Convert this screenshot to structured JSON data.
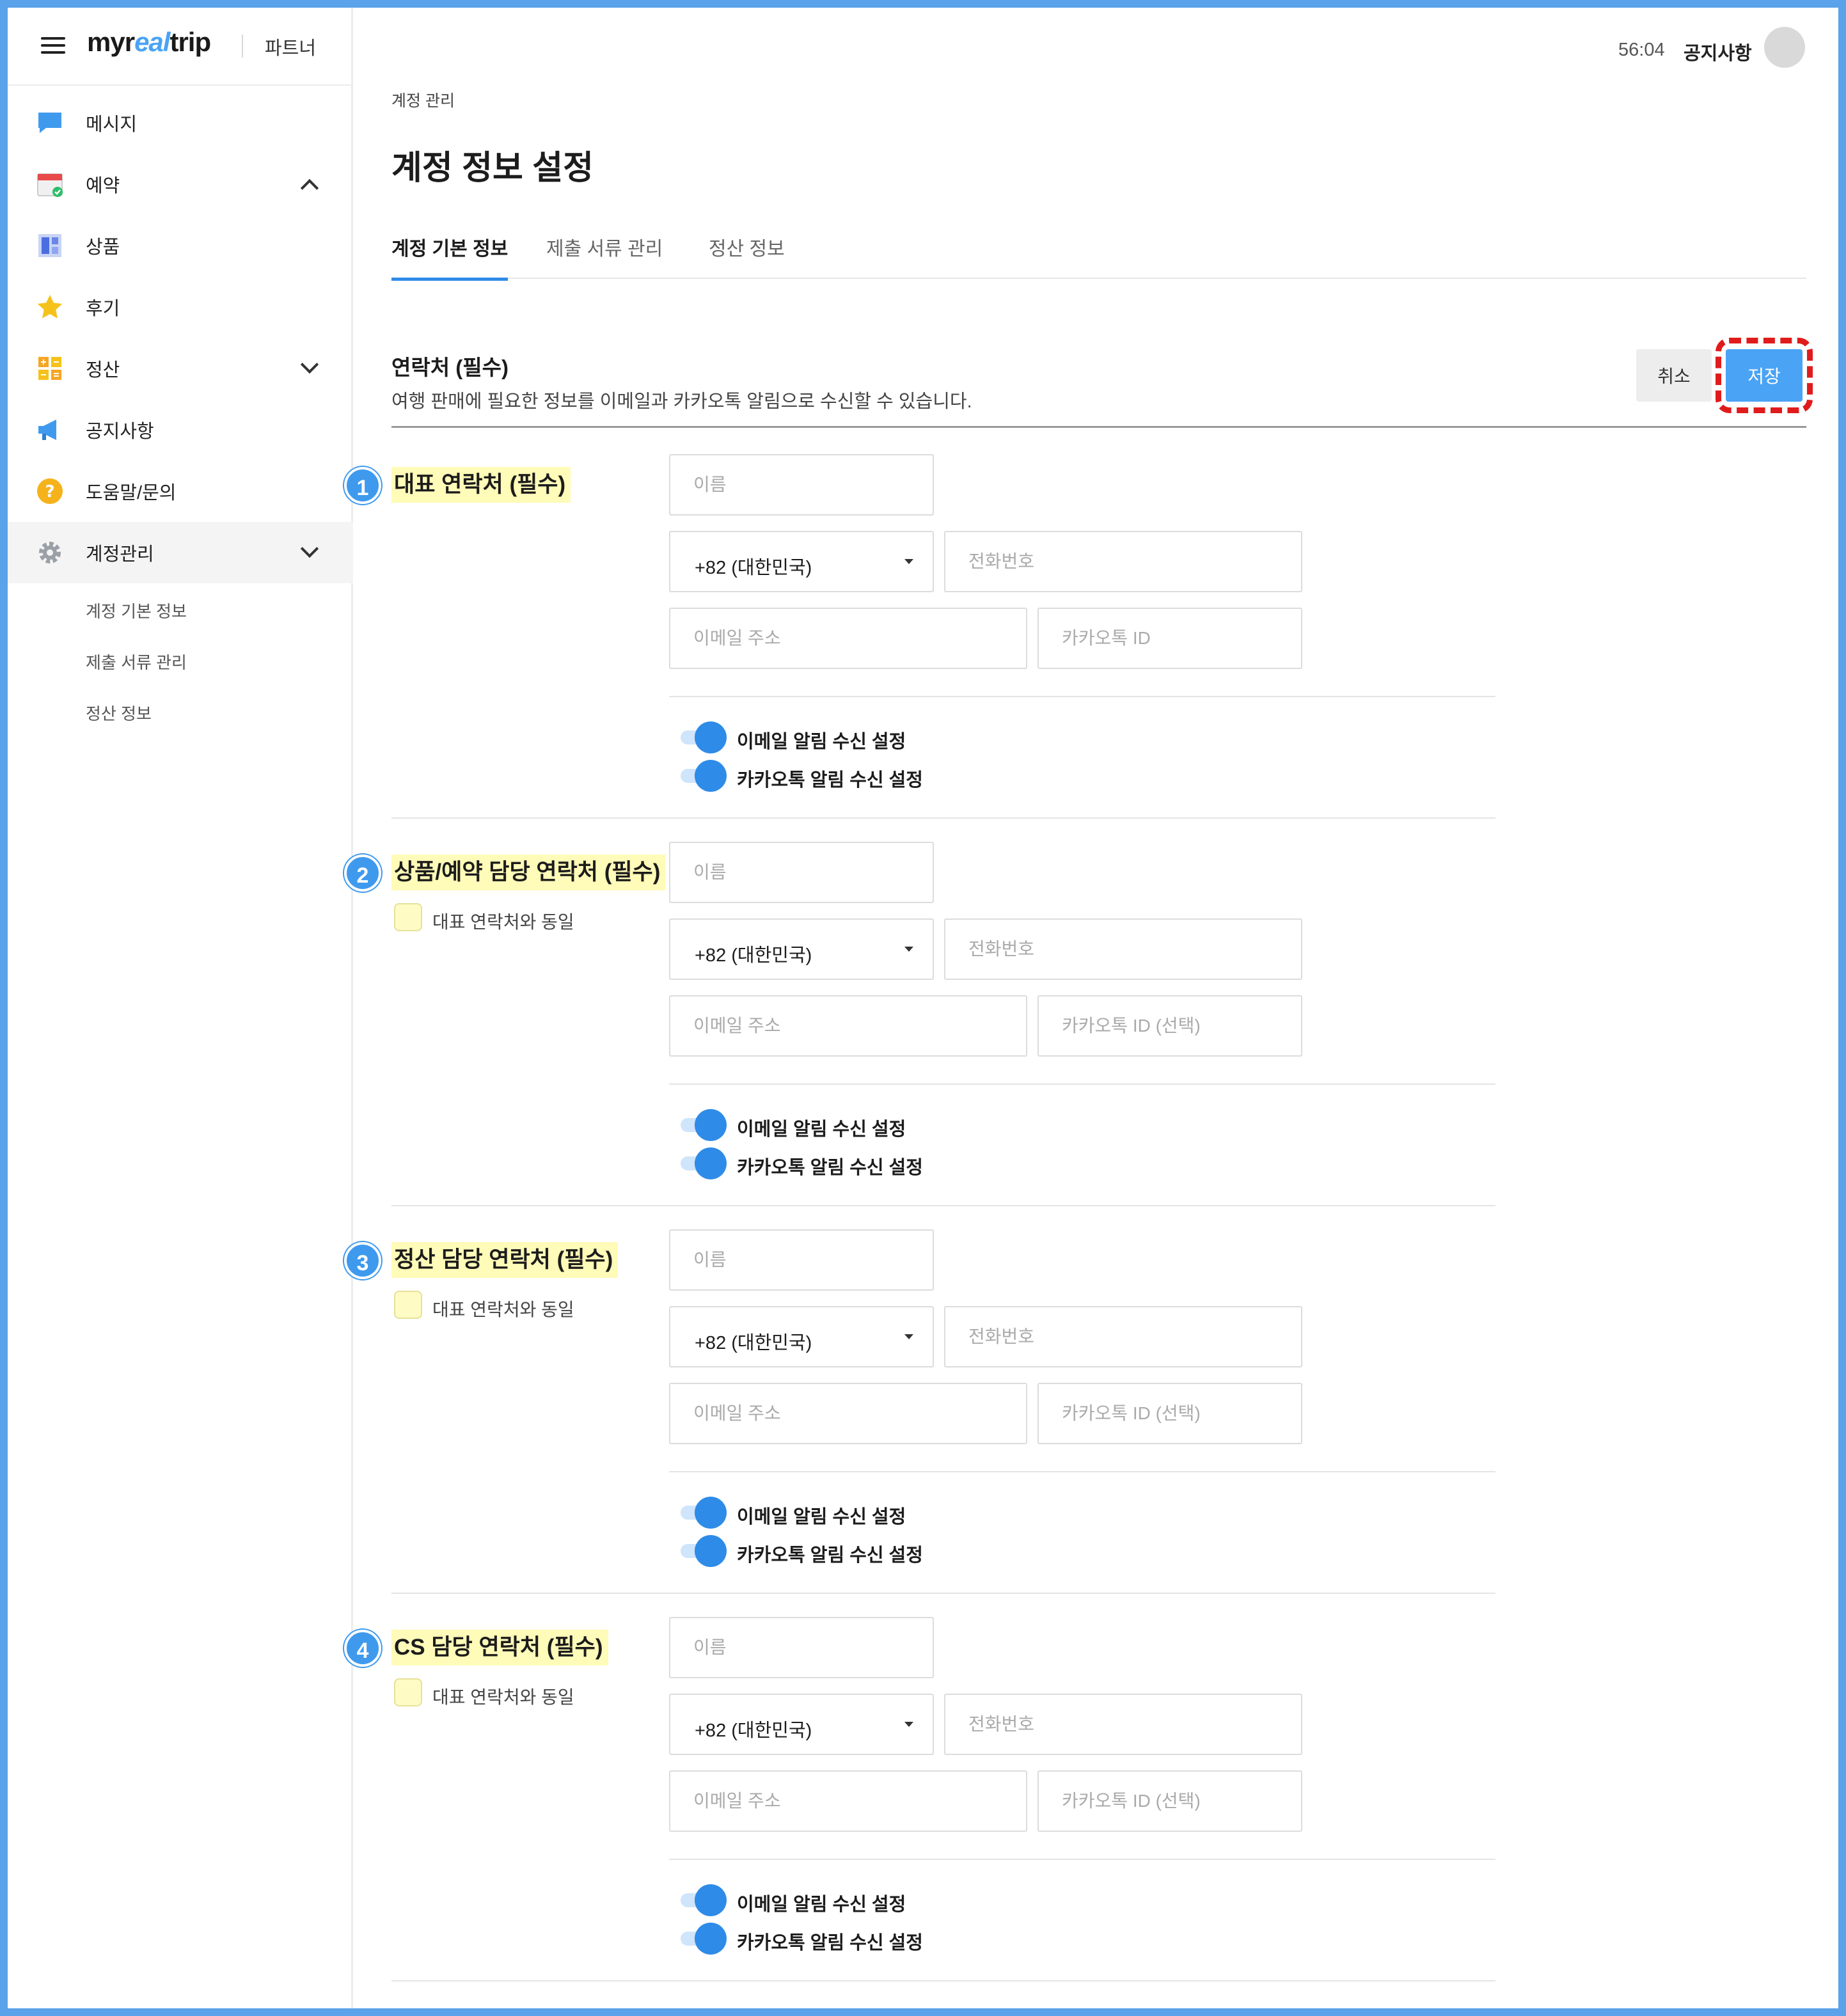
{
  "brand": {
    "logo_main": "myr",
    "logo_accent": "eal",
    "logo_end": "trip",
    "partner": "파트너"
  },
  "header": {
    "timer": "56:04",
    "notice": "공지사항"
  },
  "sidebar": {
    "items": [
      {
        "label": "메시지",
        "icon": "message-icon"
      },
      {
        "label": "예약",
        "icon": "calendar-icon"
      },
      {
        "label": "상품",
        "icon": "product-icon"
      },
      {
        "label": "후기",
        "icon": "star-icon"
      },
      {
        "label": "정산",
        "icon": "settlement-icon"
      },
      {
        "label": "공지사항",
        "icon": "megaphone-icon"
      },
      {
        "label": "도움말/문의",
        "icon": "help-icon"
      },
      {
        "label": "계정관리",
        "icon": "gear-icon"
      }
    ],
    "subitems": [
      "계정 기본 정보",
      "제출 서류 관리",
      "정산 정보"
    ]
  },
  "main": {
    "breadcrumb": "계정 관리",
    "title": "계정 정보 설정",
    "tabs": [
      "계정 기본 정보",
      "제출 서류 관리",
      "정산 정보"
    ],
    "section_title": "연락처 (필수)",
    "section_desc": "여행 판매에 필요한 정보를 이메일과 카카오톡 알림으로 수신할 수 있습니다.",
    "cancel": "취소",
    "save": "저장"
  },
  "colors": {
    "accent": "#2e8be8",
    "save_button": "#4aa3f5",
    "highlight": "#fffbb8",
    "annotation_ring": "#e01b1b"
  },
  "contacts": [
    {
      "num": "1",
      "label": "대표 연락처 (필수)",
      "name_ph": "이름",
      "country": "+82 (대한민국)",
      "phone_ph": "전화번호",
      "email_ph": "이메일 주소",
      "kakao_ph": "카카오톡 ID",
      "email_toggle": "이메일 알림 수신 설정",
      "kakao_toggle": "카카오톡 알림 수신 설정"
    },
    {
      "num": "2",
      "label": "상품/예약 담당 연락처 (필수)",
      "same": "대표 연락처와 동일",
      "name_ph": "이름",
      "country": "+82 (대한민국)",
      "phone_ph": "전화번호",
      "email_ph": "이메일 주소",
      "kakao_ph": "카카오톡 ID (선택)",
      "email_toggle": "이메일 알림 수신 설정",
      "kakao_toggle": "카카오톡 알림 수신 설정"
    },
    {
      "num": "3",
      "label": "정산 담당 연락처 (필수)",
      "same": "대표 연락처와 동일",
      "name_ph": "이름",
      "country": "+82 (대한민국)",
      "phone_ph": "전화번호",
      "email_ph": "이메일 주소",
      "kakao_ph": "카카오톡 ID (선택)",
      "email_toggle": "이메일 알림 수신 설정",
      "kakao_toggle": "카카오톡 알림 수신 설정"
    },
    {
      "num": "4",
      "label": "CS 담당 연락처 (필수)",
      "same": "대표 연락처와 동일",
      "name_ph": "이름",
      "country": "+82 (대한민국)",
      "phone_ph": "전화번호",
      "email_ph": "이메일 주소",
      "kakao_ph": "카카오톡 ID (선택)",
      "email_toggle": "이메일 알림 수신 설정",
      "kakao_toggle": "카카오톡 알림 수신 설정"
    }
  ]
}
